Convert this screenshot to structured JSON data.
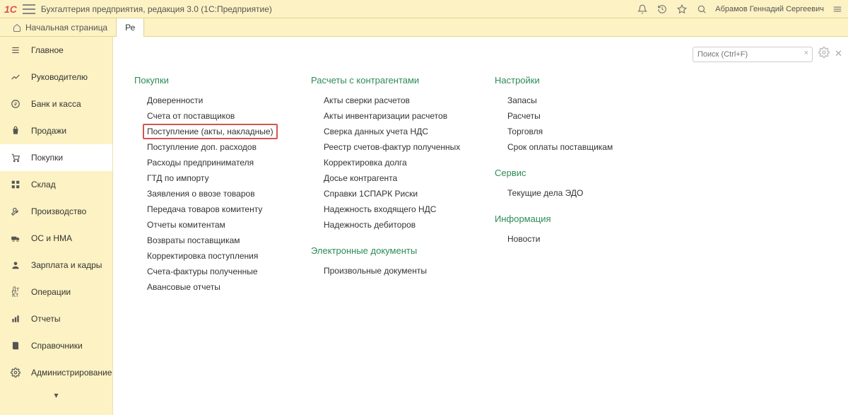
{
  "app": {
    "logo": "1C",
    "title": "Бухгалтерия предприятия, редакция 3.0   (1С:Предприятие)",
    "user": "Абрамов Геннадий Сергеевич"
  },
  "tabs": {
    "home": "Начальная страница",
    "second": "Ре"
  },
  "sidebar": [
    {
      "id": "main",
      "label": "Главное"
    },
    {
      "id": "manager",
      "label": "Руководителю"
    },
    {
      "id": "bank",
      "label": "Банк и касса"
    },
    {
      "id": "sales",
      "label": "Продажи"
    },
    {
      "id": "purchases",
      "label": "Покупки"
    },
    {
      "id": "warehouse",
      "label": "Склад"
    },
    {
      "id": "production",
      "label": "Производство"
    },
    {
      "id": "assets",
      "label": "ОС и НМА"
    },
    {
      "id": "hr",
      "label": "Зарплата и кадры"
    },
    {
      "id": "operations",
      "label": "Операции"
    },
    {
      "id": "reports",
      "label": "Отчеты"
    },
    {
      "id": "reference",
      "label": "Справочники"
    },
    {
      "id": "admin",
      "label": "Администрирование"
    }
  ],
  "search": {
    "placeholder": "Поиск (Ctrl+F)"
  },
  "columns": {
    "col1": {
      "header": "Покупки",
      "items": [
        "Доверенности",
        "Счета от поставщиков",
        "Поступление (акты, накладные)",
        "Поступление доп. расходов",
        "Расходы предпринимателя",
        "ГТД по импорту",
        "Заявления о ввозе товаров",
        "Передача товаров комитенту",
        "Отчеты комитентам",
        "Возвраты поставщикам",
        "Корректировка поступления",
        "Счета-фактуры полученные",
        "Авансовые отчеты"
      ],
      "highlighted_index": 2
    },
    "col2": {
      "sections": [
        {
          "header": "Расчеты с контрагентами",
          "items": [
            "Акты сверки расчетов",
            "Акты инвентаризации расчетов",
            "Сверка данных учета НДС",
            "Реестр счетов-фактур полученных",
            "Корректировка долга",
            "Досье контрагента",
            "Справки 1СПАРК Риски",
            "Надежность входящего НДС",
            "Надежность дебиторов"
          ]
        },
        {
          "header": "Электронные документы",
          "items": [
            "Произвольные документы"
          ]
        }
      ]
    },
    "col3": {
      "sections": [
        {
          "header": "Настройки",
          "items": [
            "Запасы",
            "Расчеты",
            "Торговля",
            "Срок оплаты поставщикам"
          ]
        },
        {
          "header": "Сервис",
          "items": [
            "Текущие дела ЭДО"
          ]
        },
        {
          "header": "Информация",
          "items": [
            "Новости"
          ]
        }
      ]
    }
  }
}
